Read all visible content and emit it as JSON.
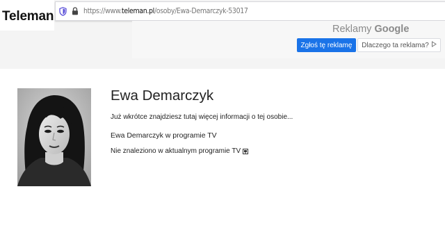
{
  "site": {
    "logo": "Teleman"
  },
  "browser": {
    "url_prefix": "https://www.",
    "url_host": "teleman.pl",
    "url_path": "/osoby/Ewa-Demarczyk-53017"
  },
  "ad": {
    "label_prefix": "Reklamy",
    "label_brand": "Google",
    "report_button": "Zgłoś tę reklamę",
    "why_button": "Dlaczego ta reklama?"
  },
  "person": {
    "name": "Ewa Demarczyk",
    "intro": "Już wkrótce znajdziesz tutaj więcej informacji o tej osobie...",
    "tv_heading": "Ewa Demarczyk w programie TV",
    "not_found": "Nie znaleziono w aktualnym programie TV"
  }
}
